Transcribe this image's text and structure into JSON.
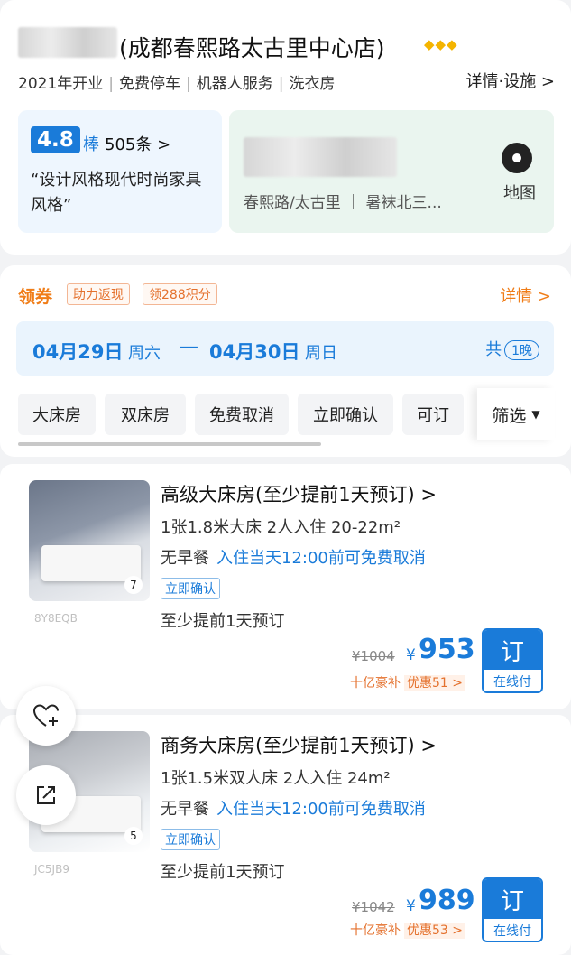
{
  "hotel": {
    "title": "(成都春熙路太古里中心店)",
    "diamonds": "◆◆◆",
    "tags": [
      "2021年开业",
      "免费停车",
      "机器人服务",
      "洗衣房"
    ],
    "details_label": "详情·设施 >"
  },
  "rating": {
    "score": "4.8",
    "grade": "棒",
    "reviews": "505条 >",
    "quote": "“设计风格现代时尚家具风格”"
  },
  "map": {
    "location": "春熙路/太古里 ｜ 暑袜北三...",
    "label": "地图"
  },
  "booking": {
    "coupon_label": "领券",
    "coupon_tags": [
      "助力返现",
      "领288积分"
    ],
    "details_label": "详情 >",
    "checkin_date": "04月29日",
    "checkin_weekday": "周六",
    "dash": "—",
    "checkout_date": "04月30日",
    "checkout_weekday": "周日",
    "total_prefix": "共",
    "nights": "1晚"
  },
  "filters": {
    "chips": [
      "大床房",
      "双床房",
      "免费取消",
      "立即确认",
      "可订"
    ],
    "filter_label": "筛选",
    "filter_icon": "▼"
  },
  "rooms": [
    {
      "name": "高级大床房(至少提前1天预订) >",
      "spec": "1张1.8米大床 2人入住 20-22m²",
      "breakfast": "无早餐",
      "cancel": "入住当天12:00前可免费取消",
      "confirm_tag": "立即确认",
      "advance": "至少提前1天预订",
      "photo_count": "7",
      "code": "8Y8EQB",
      "old_price": "¥1004",
      "currency": "¥",
      "price": "953",
      "subsidy": "十亿豪补",
      "discount": "优惠51 >",
      "book_label": "订",
      "pay_label": "在线付"
    },
    {
      "name": "商务大床房(至少提前1天预订) >",
      "spec": "1张1.5米双人床 2人入住 24m²",
      "breakfast": "无早餐",
      "cancel": "入住当天12:00前可免费取消",
      "confirm_tag": "立即确认",
      "advance": "至少提前1天预订",
      "photo_count": "5",
      "code": "JC5JB9",
      "old_price": "¥1042",
      "currency": "¥",
      "price": "989",
      "subsidy": "十亿豪补",
      "discount": "优惠53 >",
      "book_label": "订",
      "pay_label": "在线付"
    }
  ],
  "colors": {
    "accent": "#1a7bd9",
    "orange": "#f07d18",
    "background": "#f2f3f5"
  },
  "icons": {
    "favorite": "heart-plus-icon",
    "share": "share-icon",
    "map": "map-pin-icon"
  }
}
